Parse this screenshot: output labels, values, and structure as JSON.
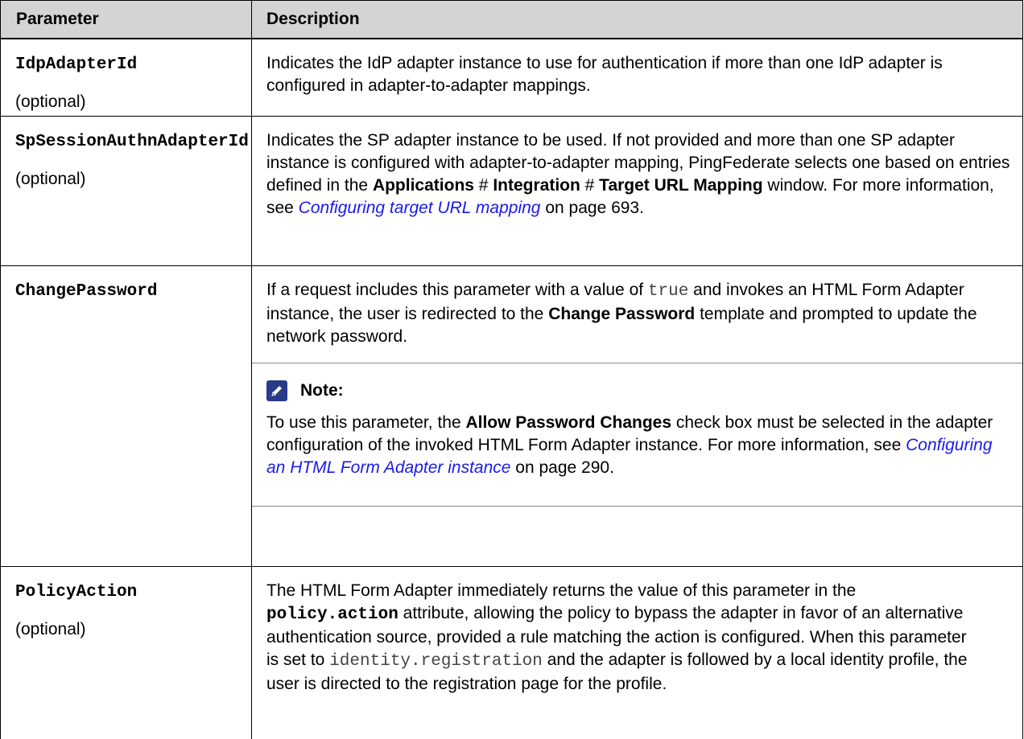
{
  "table": {
    "header": {
      "parameter": "Parameter",
      "description": "Description"
    },
    "rows": {
      "r1": {
        "name": "IdpAdapterId",
        "optional": "(optional)",
        "desc": "Indicates the IdP adapter instance to use for authentication if more than one IdP adapter is configured in adapter-to-adapter mappings."
      },
      "r2": {
        "name": "SpSessionAuthnAdapterId",
        "optional": "(optional)",
        "desc_a": "Indicates the SP adapter instance to be used. If not provided and more than one SP adapter instance is configured with adapter-to-adapter mapping, PingFederate selects one based on entries defined in the ",
        "bold_applications": "Applications",
        "hash1": " # ",
        "bold_integration": "Integration",
        "hash2": " # ",
        "bold_target": "Target URL Mapping",
        "desc_b": " window. For more information, see ",
        "link": "Configuring target URL mapping",
        "desc_c": " on page 693."
      },
      "r3": {
        "name": "ChangePassword",
        "desc_a": "If a request includes this parameter with a value of ",
        "code_true": "true",
        "desc_b": " and invokes an HTML Form Adapter instance, the user is redirected to the ",
        "bold_change": "Change Password",
        "desc_c": " template and prompted to update the network password.",
        "note": {
          "icon": "pencil-note-icon",
          "title": "Note:",
          "text_a": "To use this parameter, the ",
          "bold_allow": "Allow Password Changes",
          "text_b": " check box must be selected in the adapter configuration of the invoked HTML Form Adapter instance. For more information, see ",
          "link": "Configuring an HTML Form Adapter instance",
          "text_c": " on page 290."
        }
      },
      "r4": {
        "name": "PolicyAction",
        "optional": "(optional)",
        "desc_a": "The HTML Form Adapter immediately returns the value of this parameter in the ",
        "code_policy": "policy.action",
        "desc_b": " attribute, allowing the policy to bypass the adapter in favor of an alternative authentication source, provided a rule matching the action is configured. When this parameter is set to ",
        "code_identity": "identity.registration",
        "desc_c": " and the adapter is followed by a local identity profile, the user is directed to the registration page for the profile."
      }
    }
  },
  "colors": {
    "header_bg": "#d4d4d4",
    "link": "#1a1aee",
    "note_icon": "#2a3a8a"
  }
}
